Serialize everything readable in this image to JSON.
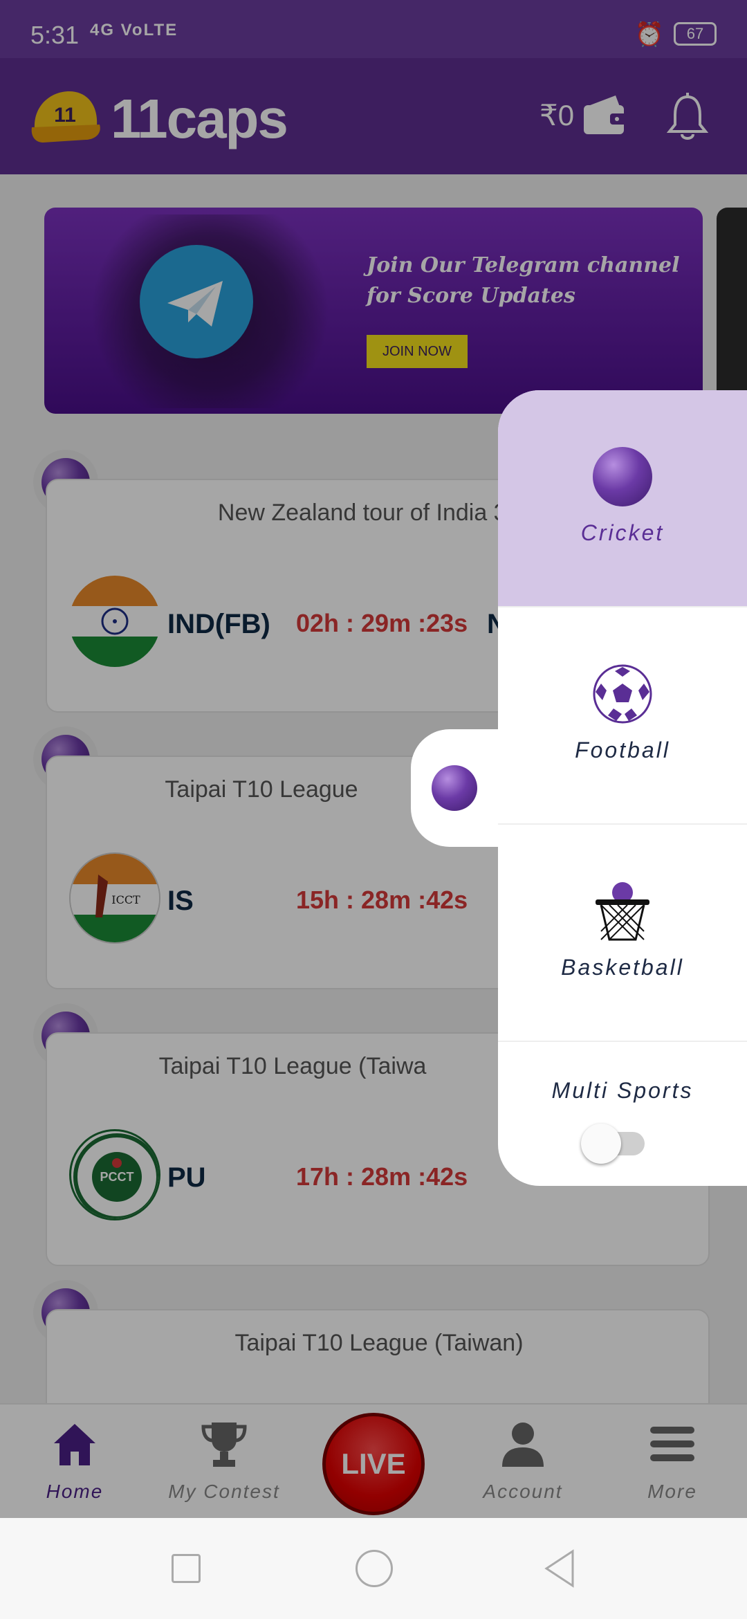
{
  "status_bar": {
    "time": "5:31",
    "signal_text": "4G VoLTE",
    "battery": "67"
  },
  "header": {
    "logo_text": "11caps",
    "logo_cap_number": "11",
    "balance": "₹0"
  },
  "banner": {
    "text_line1": "Join Our Telegram channel",
    "text_line2": "for Score Updates",
    "cta": "JOIN NOW"
  },
  "matches": [
    {
      "league": "New Zealand tour of India 3 T2",
      "team1": "IND(FB)",
      "timer": "02h : 29m :23s",
      "team2": "N"
    },
    {
      "league": "Taipai T10 League",
      "team1": "IS",
      "timer": "15h : 28m :42s",
      "team2": ""
    },
    {
      "league": "Taipai T10 League (Taiwa",
      "team1": "PU",
      "timer": "17h : 28m :42s",
      "team2": ""
    },
    {
      "league": "Taipai T10 League (Taiwan)",
      "team1": "",
      "timer": "",
      "team2": ""
    }
  ],
  "drawer": {
    "items": [
      {
        "label": "Cricket",
        "icon": "cricket-ball-icon",
        "selected": true
      },
      {
        "label": "Football",
        "icon": "football-icon",
        "selected": false
      },
      {
        "label": "Basketball",
        "icon": "basketball-icon",
        "selected": false
      }
    ],
    "multi_sports_label": "Multi Sports",
    "multi_sports_enabled": false
  },
  "bottom_nav": {
    "items": [
      {
        "label": "Home",
        "icon": "home-icon"
      },
      {
        "label": "My Contest",
        "icon": "trophy-icon"
      },
      {
        "label": "Account",
        "icon": "account-icon"
      },
      {
        "label": "More",
        "icon": "menu-icon"
      }
    ],
    "live_label": "LIVE"
  },
  "colors": {
    "brand": "#5e2f91",
    "accent_red": "#d53a3a",
    "selected_bg": "#d4c6e6"
  }
}
